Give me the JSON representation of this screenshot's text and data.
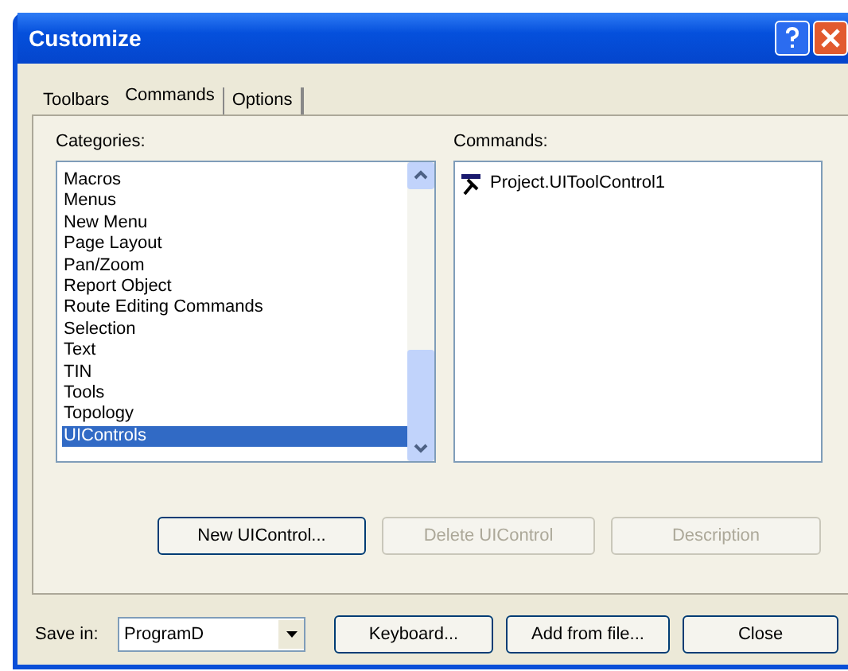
{
  "window": {
    "title": "Customize"
  },
  "tabs": [
    {
      "label": "Toolbars",
      "selected": false
    },
    {
      "label": "Commands",
      "selected": true
    },
    {
      "label": "Options",
      "selected": false
    }
  ],
  "categories": {
    "label": "Categories:",
    "items": [
      {
        "label": "Macros",
        "selected": false
      },
      {
        "label": "Menus",
        "selected": false
      },
      {
        "label": "New Menu",
        "selected": false
      },
      {
        "label": "Page Layout",
        "selected": false
      },
      {
        "label": "Pan/Zoom",
        "selected": false
      },
      {
        "label": "Report Object",
        "selected": false
      },
      {
        "label": "Route Editing Commands",
        "selected": false
      },
      {
        "label": "Selection",
        "selected": false
      },
      {
        "label": "Text",
        "selected": false
      },
      {
        "label": "TIN",
        "selected": false
      },
      {
        "label": "Tools",
        "selected": false
      },
      {
        "label": "Topology",
        "selected": false
      },
      {
        "label": "UIControls",
        "selected": true
      }
    ]
  },
  "commands": {
    "label": "Commands:",
    "items": [
      {
        "label": "Project.UIToolControl1"
      }
    ]
  },
  "panel_buttons": [
    {
      "label": "New UIControl...",
      "disabled": false
    },
    {
      "label": "Delete UIControl",
      "disabled": true
    },
    {
      "label": "Description",
      "disabled": true
    }
  ],
  "save_in": {
    "label": "Save in:",
    "value": "ProgramD"
  },
  "footer_buttons": [
    {
      "label": "Keyboard..."
    },
    {
      "label": "Add from file..."
    },
    {
      "label": "Close"
    }
  ]
}
